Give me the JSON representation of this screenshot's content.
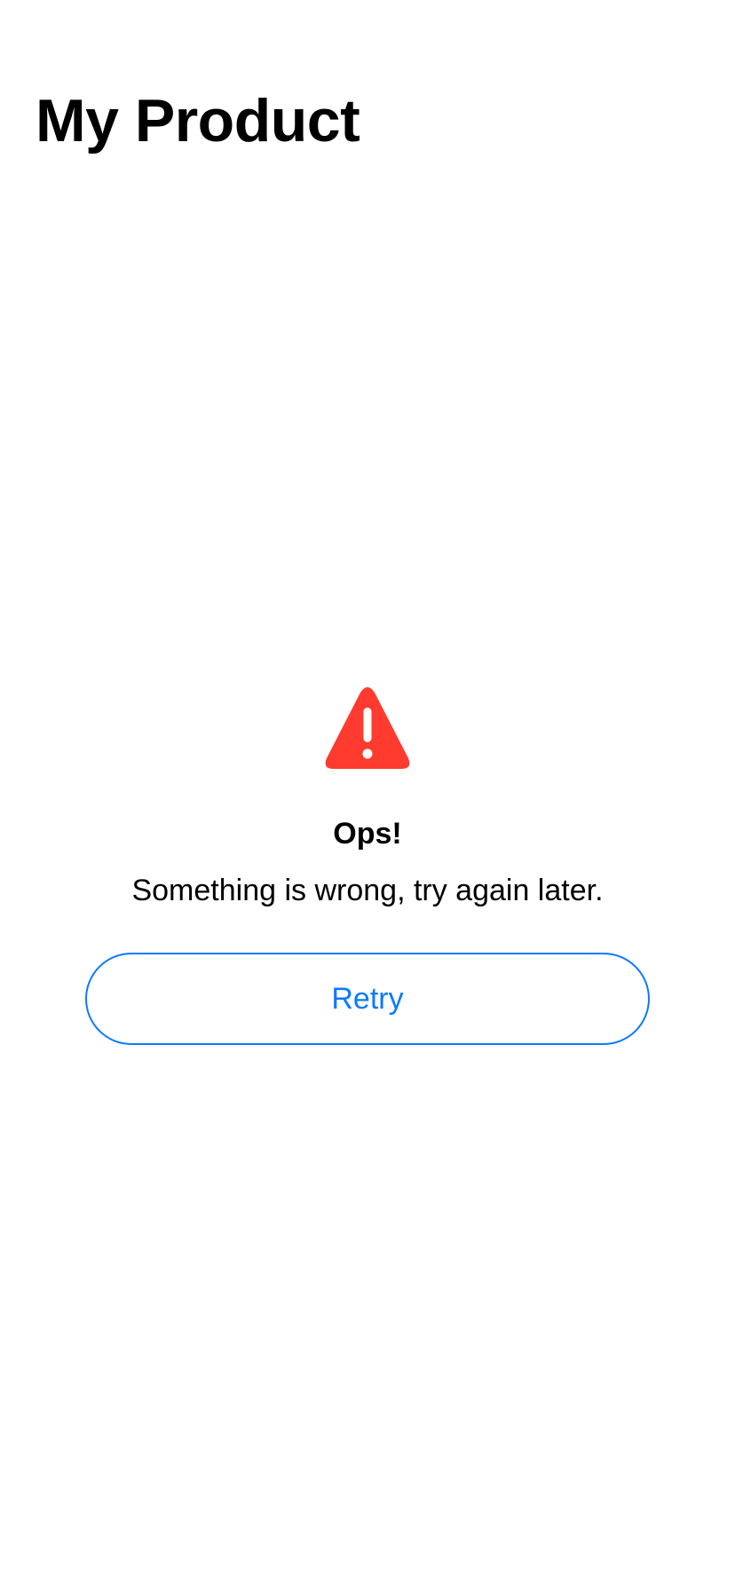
{
  "header": {
    "title": "My Product"
  },
  "error": {
    "icon": "warning-triangle-icon",
    "icon_color": "#ff3b30",
    "title": "Ops!",
    "message": "Something is wrong, try again later."
  },
  "actions": {
    "retry_label": "Retry",
    "accent_color": "#0a7aff"
  }
}
